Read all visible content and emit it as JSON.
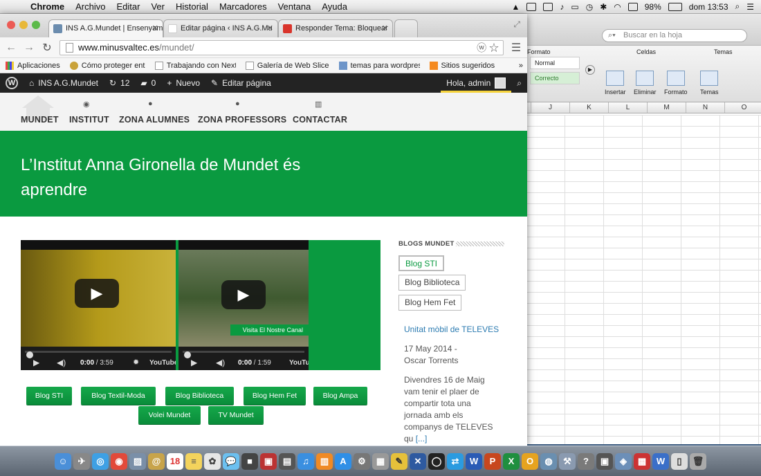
{
  "menubar": {
    "app": "Chrome",
    "items": [
      "Archivo",
      "Editar",
      "Ver",
      "Historial",
      "Marcadores",
      "Ventana",
      "Ayuda"
    ],
    "battery": "98%",
    "clock": "dom 13:53"
  },
  "excel": {
    "search_placeholder": "Buscar en la hoja",
    "groups": [
      "Formato",
      "Celdas",
      "Temas"
    ],
    "styles": [
      "Normal",
      "Correcto"
    ],
    "buttons": [
      "Insertar",
      "Eliminar",
      "Formato",
      "Temas"
    ],
    "columns": [
      "J",
      "K",
      "L",
      "M",
      "N",
      "O"
    ]
  },
  "browser": {
    "tabs": [
      {
        "title": "INS A.G.Mundet | Ensenyam",
        "color": "#6b8cae"
      },
      {
        "title": "Editar página ‹ INS A.G.Mu",
        "color": "#ffffff"
      },
      {
        "title": "Responder Tema: Bloquear",
        "color": "#d9342b"
      }
    ],
    "url_host": "www.minusvaltec.es",
    "url_path": "/mundet/",
    "bookmarks": [
      "Aplicaciones",
      "Cómo proteger entra",
      "Trabajando con Next",
      "Galería de Web Slice",
      "temas para wordpres",
      "Sitios sugeridos"
    ]
  },
  "wpbar": {
    "site": "INS A.G.Mundet",
    "updates": "12",
    "comments": "0",
    "new": "Nuevo",
    "edit": "Editar página",
    "greeting": "Hola, admin"
  },
  "nav": [
    "MUNDET",
    "INSTITUT",
    "ZONA ALUMNES",
    "ZONA PROFESSORS",
    "CONTACTAR"
  ],
  "hero": {
    "line1": "L’Institut Anna Gironella de Mundet és",
    "line2": "aprendre"
  },
  "videos": [
    {
      "time": "0:00",
      "duration": "/ 3:59",
      "progress": 0
    },
    {
      "time": "0:00",
      "duration": "/ 1:59",
      "progress": 0,
      "caption": "Visita El Nostre Canal"
    }
  ],
  "green_buttons": [
    "Blog STI",
    "Blog Textil-Moda",
    "Blog Biblioteca",
    "Blog Hem Fet",
    "Blog Ampa",
    "Volei Mundet",
    "TV Mundet"
  ],
  "sidebar": {
    "title": "BLOGS MUNDET",
    "buttons": [
      "Blog STI",
      "Blog Biblioteca",
      "Blog Hem Fet"
    ],
    "post_title": "Unitat mòbil de TELEVES",
    "post_date": "17 May 2014 -",
    "post_author": "Oscar Torrents",
    "post_excerpt": [
      "Divendres 16 de Maig",
      "vam tenir el plaer de",
      "compartir tota una",
      "jornada amb els",
      "companys de TELEVES",
      "qu"
    ],
    "read_more": "[...]"
  }
}
